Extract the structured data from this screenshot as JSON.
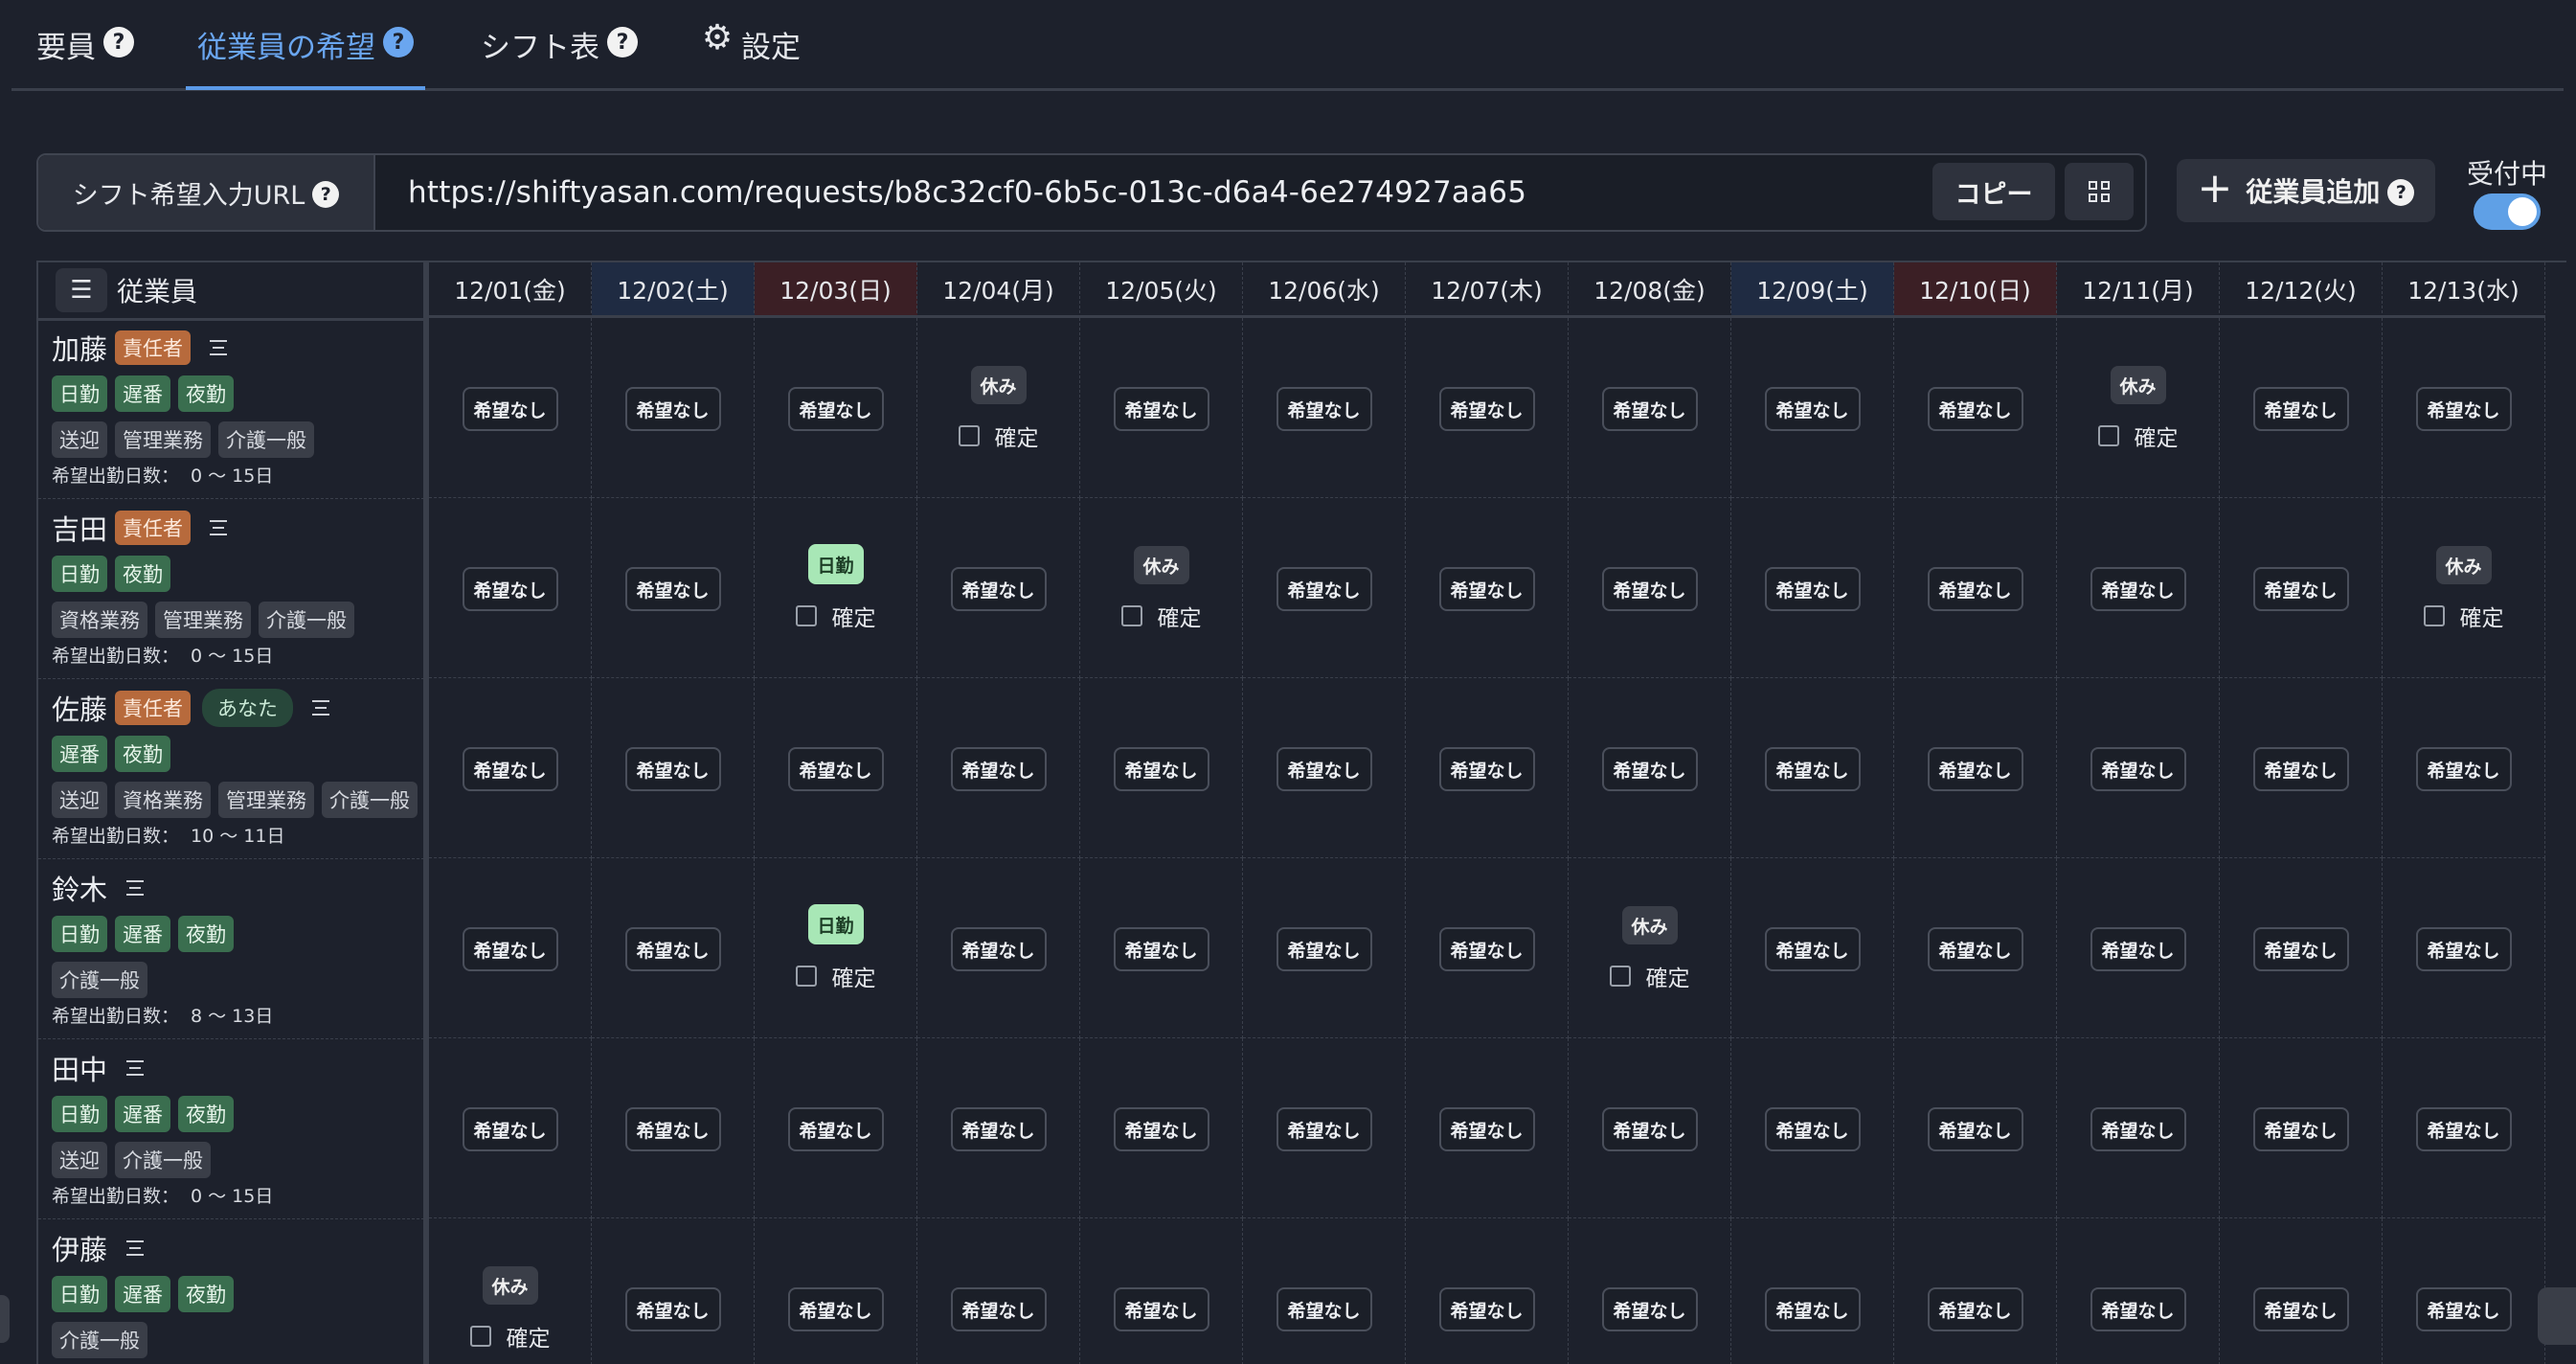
{
  "tabs": [
    {
      "label": "要員",
      "help": "?"
    },
    {
      "label": "従業員の希望",
      "help": "?"
    },
    {
      "label": "シフト表",
      "help": "?"
    },
    {
      "label": "設定",
      "icon": "gear-icon"
    }
  ],
  "active_tab": "従業員の希望",
  "url_section": {
    "label": "シフト希望入力URL",
    "help": "?",
    "url": "https://shiftyasan.com/requests/b8c32cf0-6b5c-013c-d6a4-6e274927aa65",
    "copy_label": "コピー",
    "qr_icon": "qr-code-icon"
  },
  "add_employee": {
    "label": "従業員追加",
    "help": "?",
    "icon": "plus-icon"
  },
  "accepting": {
    "label": "受付中",
    "on": true
  },
  "grid": {
    "corner_label": "従業員",
    "corner_icon": "list-icon",
    "dates": [
      {
        "label": "12/01(金)",
        "kind": "weekday"
      },
      {
        "label": "12/02(土)",
        "kind": "sat"
      },
      {
        "label": "12/03(日)",
        "kind": "sun"
      },
      {
        "label": "12/04(月)",
        "kind": "weekday"
      },
      {
        "label": "12/05(火)",
        "kind": "weekday"
      },
      {
        "label": "12/06(水)",
        "kind": "weekday"
      },
      {
        "label": "12/07(木)",
        "kind": "weekday"
      },
      {
        "label": "12/08(金)",
        "kind": "weekday"
      },
      {
        "label": "12/09(土)",
        "kind": "sat"
      },
      {
        "label": "12/10(日)",
        "kind": "sun"
      },
      {
        "label": "12/11(月)",
        "kind": "weekday"
      },
      {
        "label": "12/12(火)",
        "kind": "weekday"
      },
      {
        "label": "12/13(水)",
        "kind": "weekday"
      }
    ],
    "labels": {
      "none": "希望なし",
      "off": "休み",
      "day": "日勤",
      "confirm": "確定",
      "days_prefix": "希望出勤日数："
    },
    "employees": [
      {
        "name": "加藤",
        "lead": "責任者",
        "you": null,
        "shifts": [
          "日勤",
          "遅番",
          "夜勤"
        ],
        "skills": [
          "送迎",
          "管理業務",
          "介護一般"
        ],
        "days": "0 〜 15日",
        "requests": [
          "none",
          "none",
          "none",
          "off",
          "none",
          "none",
          "none",
          "none",
          "none",
          "none",
          "off",
          "none",
          "none"
        ]
      },
      {
        "name": "吉田",
        "lead": "責任者",
        "you": null,
        "shifts": [
          "日勤",
          "夜勤"
        ],
        "skills": [
          "資格業務",
          "管理業務",
          "介護一般"
        ],
        "days": "0 〜 15日",
        "requests": [
          "none",
          "none",
          "day",
          "none",
          "off",
          "none",
          "none",
          "none",
          "none",
          "none",
          "none",
          "none",
          "off"
        ]
      },
      {
        "name": "佐藤",
        "lead": "責任者",
        "you": "あなた",
        "shifts": [
          "遅番",
          "夜勤"
        ],
        "skills": [
          "送迎",
          "資格業務",
          "管理業務",
          "介護一般"
        ],
        "days": "10 〜 11日",
        "requests": [
          "none",
          "none",
          "none",
          "none",
          "none",
          "none",
          "none",
          "none",
          "none",
          "none",
          "none",
          "none",
          "none"
        ]
      },
      {
        "name": "鈴木",
        "lead": null,
        "you": null,
        "shifts": [
          "日勤",
          "遅番",
          "夜勤"
        ],
        "skills": [
          "介護一般"
        ],
        "days": "8 〜 13日",
        "requests": [
          "none",
          "none",
          "day",
          "none",
          "none",
          "none",
          "none",
          "off",
          "none",
          "none",
          "none",
          "none",
          "none"
        ]
      },
      {
        "name": "田中",
        "lead": null,
        "you": null,
        "shifts": [
          "日勤",
          "遅番",
          "夜勤"
        ],
        "skills": [
          "送迎",
          "介護一般"
        ],
        "days": "0 〜 15日",
        "requests": [
          "none",
          "none",
          "none",
          "none",
          "none",
          "none",
          "none",
          "none",
          "none",
          "none",
          "none",
          "none",
          "none"
        ]
      },
      {
        "name": "伊藤",
        "lead": null,
        "you": null,
        "shifts": [
          "日勤",
          "遅番",
          "夜勤"
        ],
        "skills": [
          "介護一般"
        ],
        "days": "",
        "requests": [
          "off",
          "none",
          "none",
          "none",
          "none",
          "none",
          "none",
          "none",
          "none",
          "none",
          "none",
          "none",
          "none"
        ]
      }
    ]
  },
  "colors": {
    "background": "#1d212c",
    "accent": "#5b9ae8",
    "lead_badge": "#b76a3c",
    "shift_chip": "#3a6e4f",
    "day_shift_pill": "#a8e7b6",
    "saturday_header": "#1f2b42",
    "sunday_header": "#3b1f25"
  }
}
